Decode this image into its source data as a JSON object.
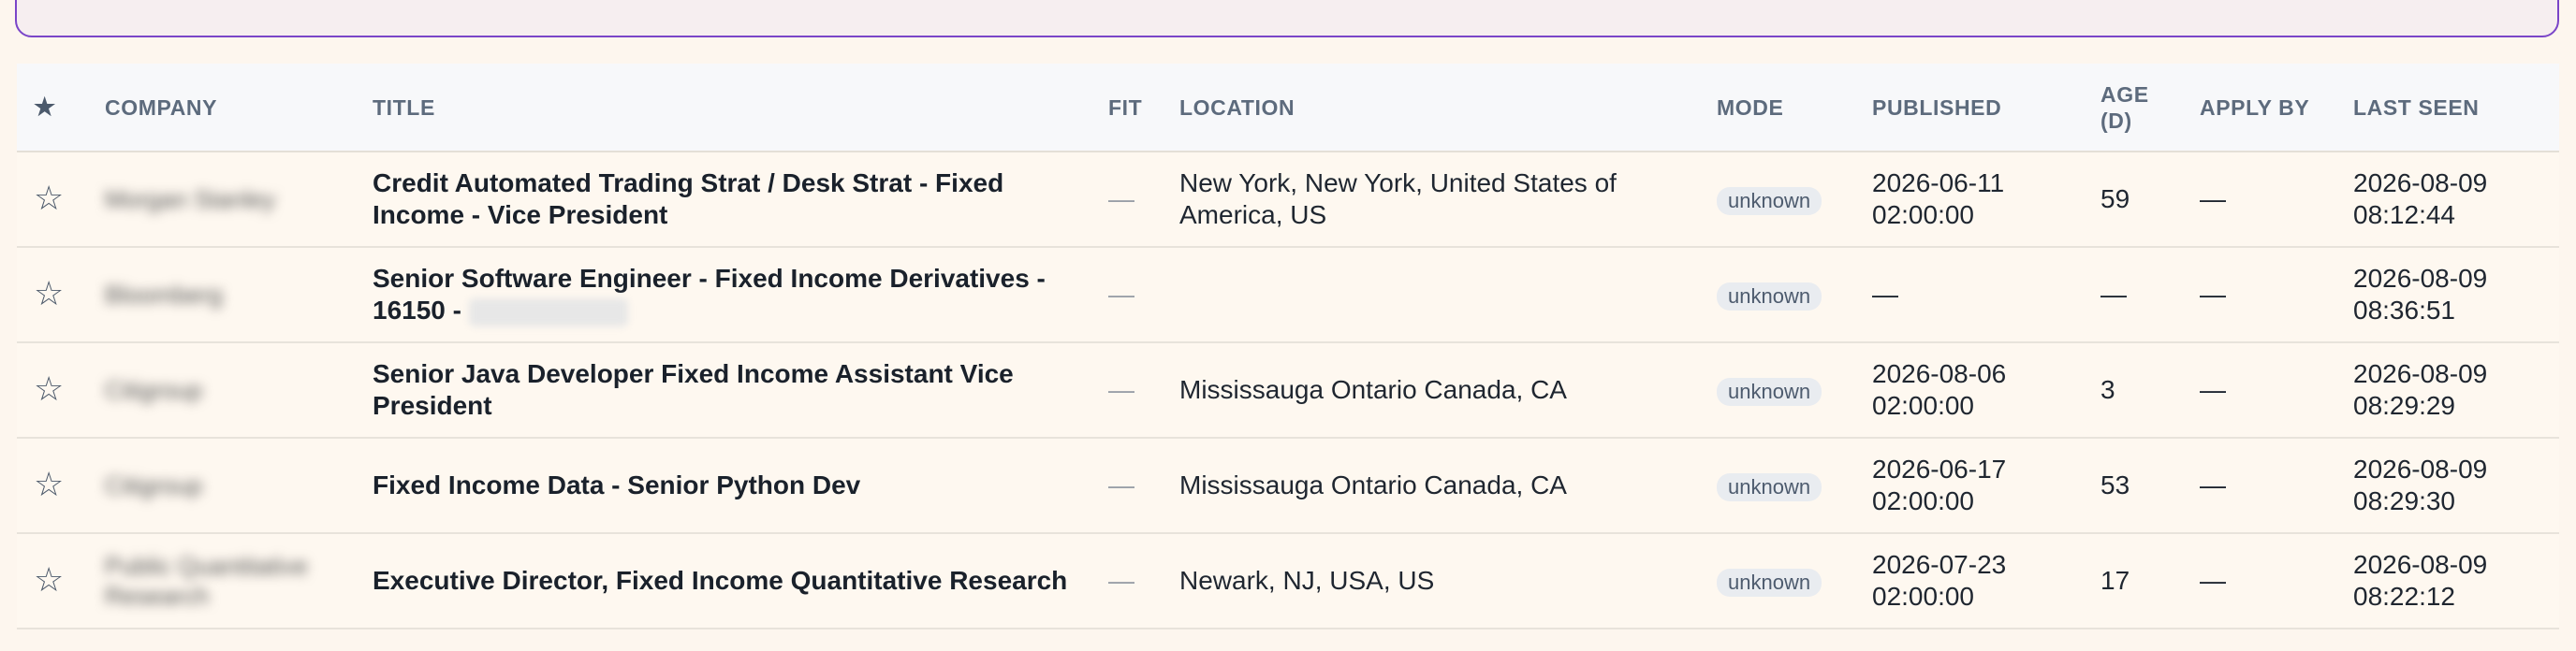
{
  "headers": {
    "star": "★",
    "company": "COMPANY",
    "title": "TITLE",
    "fit": "FIT",
    "location": "LOCATION",
    "mode": "MODE",
    "published": "PUBLISHED",
    "age_line1": "AGE",
    "age_line2": "(D)",
    "apply_by": "APPLY BY",
    "last_seen": "LAST SEEN"
  },
  "rows": [
    {
      "star": "☆",
      "company": "Morgan Stanley",
      "title": "Credit Automated Trading Strat / Desk Strat - Fixed Income - Vice President",
      "title_tail": "",
      "fit": "—",
      "location": "New York, New York, United States of America, US",
      "mode": "unknown",
      "published_date": "2026-06-11",
      "published_time": "02:00:00",
      "age": "59",
      "apply_by": "—",
      "last_seen_date": "2026-08-09",
      "last_seen_time": "08:12:44"
    },
    {
      "star": "☆",
      "company": "Bloomberg",
      "title": "Senior Software Engineer - Fixed Income Derivatives - 16150 -",
      "title_tail": "",
      "fit": "—",
      "location": "",
      "mode": "unknown",
      "published_date": "—",
      "published_time": "",
      "age": "—",
      "apply_by": "—",
      "last_seen_date": "2026-08-09",
      "last_seen_time": "08:36:51"
    },
    {
      "star": "☆",
      "company": "Citigroup",
      "title": "Senior Java Developer Fixed Income Assistant Vice President",
      "title_tail": "",
      "fit": "—",
      "location": "Mississauga Ontario Canada, CA",
      "mode": "unknown",
      "published_date": "2026-08-06",
      "published_time": "02:00:00",
      "age": "3",
      "apply_by": "—",
      "last_seen_date": "2026-08-09",
      "last_seen_time": "08:29:29"
    },
    {
      "star": "☆",
      "company": "Citigroup",
      "title": "Fixed Income Data - Senior Python Dev",
      "title_tail": "",
      "fit": "—",
      "location": "Mississauga Ontario Canada, CA",
      "mode": "unknown",
      "published_date": "2026-06-17",
      "published_time": "02:00:00",
      "age": "53",
      "apply_by": "—",
      "last_seen_date": "2026-08-09",
      "last_seen_time": "08:29:30"
    },
    {
      "star": "☆",
      "company": "Public Quantitative Research",
      "title": "Executive Director, Fixed Income Quantitative Research",
      "title_tail": "",
      "fit": "—",
      "location": "Newark, NJ, USA, US",
      "mode": "unknown",
      "published_date": "2026-07-23",
      "published_time": "02:00:00",
      "age": "17",
      "apply_by": "—",
      "last_seen_date": "2026-08-09",
      "last_seen_time": "08:22:12"
    }
  ]
}
